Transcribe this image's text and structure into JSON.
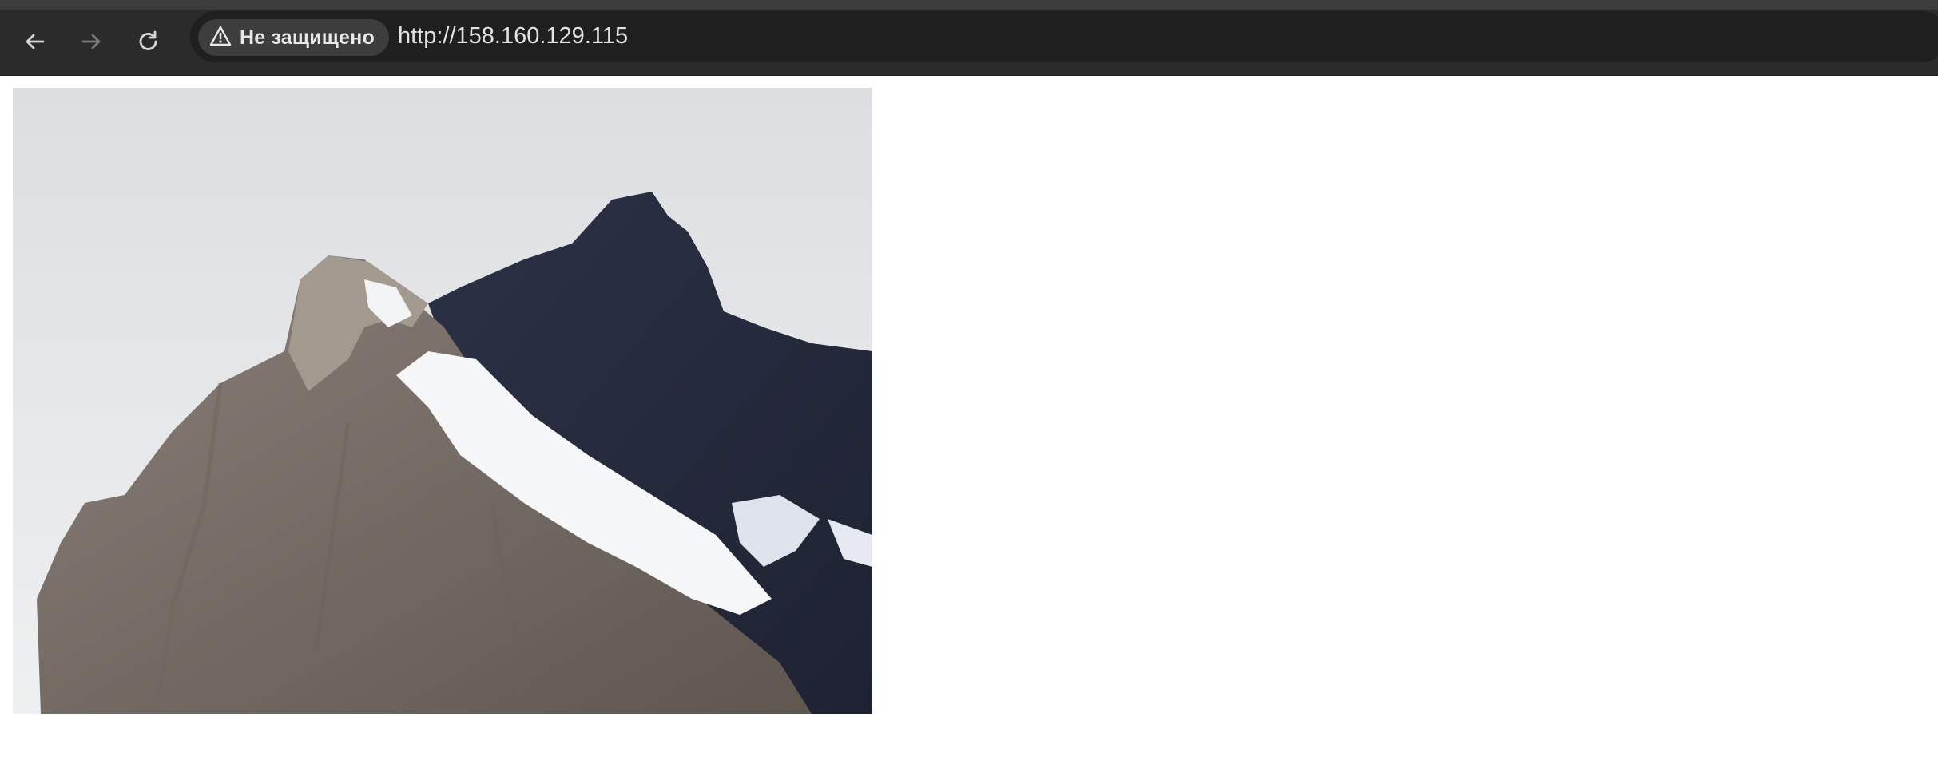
{
  "browser": {
    "nav": {
      "back_icon": "arrow-left-icon",
      "forward_icon": "arrow-right-icon",
      "reload_icon": "reload-icon"
    },
    "security": {
      "icon": "warning-triangle-icon",
      "label": "Не защищено"
    },
    "url": "http://158.160.129.115"
  },
  "page": {
    "image": {
      "subject": "mountain-peak-photo"
    }
  },
  "colors": {
    "toolbar": "#2b2b2b",
    "omnibox": "#1f1f1f",
    "chip": "#3d3d3d",
    "page_bg": "#ffffff"
  }
}
